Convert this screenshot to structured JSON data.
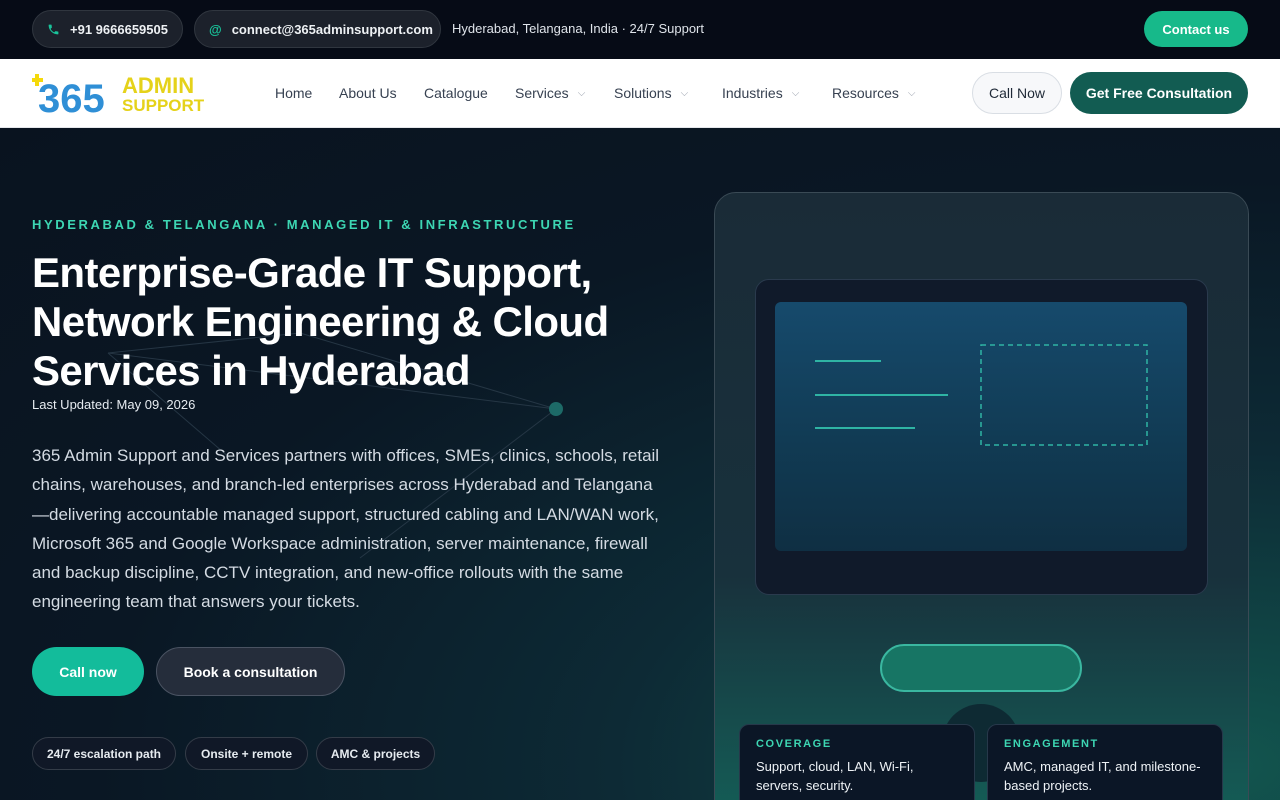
{
  "topbar": {
    "phone": "+91 9666659505",
    "email": "connect@365adminsupport.com",
    "location": "Hyderabad, Telangana, India · 24/7 Support",
    "contact_label": "Contact us"
  },
  "logo": {
    "line1": "365",
    "line2": "ADMIN",
    "line3": "SUPPORT"
  },
  "nav": {
    "items": [
      {
        "label": "Home"
      },
      {
        "label": "About Us"
      },
      {
        "label": "Catalogue"
      },
      {
        "label": "Services"
      },
      {
        "label": "Solutions"
      },
      {
        "label": "Industries"
      },
      {
        "label": "Resources"
      }
    ],
    "call_now": "Call Now",
    "consultation": "Get Free Consultation"
  },
  "hero": {
    "kicker": "HYDERABAD & TELANGANA · MANAGED IT & INFRASTRUCTURE",
    "headline": "Enterprise-Grade IT Support, Network Engineering & Cloud Services in Hyderabad",
    "updated": "Last Updated: May 09, 2026",
    "description": "365 Admin Support and Services partners with offices, SMEs, clinics, schools, retail chains, warehouses, and branch-led enterprises across Hyderabad and Telangana—delivering accountable managed support, structured cabling and LAN/WAN work, Microsoft 365 and Google Workspace administration, server maintenance, firewall and backup discipline, CCTV integration, and new-office rollouts with the same engineering team that answers your tickets.",
    "cta_call": "Call now",
    "cta_book": "Book a consultation",
    "chips": [
      "24/7 escalation path",
      "Onsite + remote",
      "AMC & projects"
    ]
  },
  "cards": [
    {
      "label": "COVERAGE",
      "text": "Support, cloud, LAN, Wi-Fi, servers, security."
    },
    {
      "label": "ENGAGEMENT",
      "text": "AMC, managed IT, and milestone-based projects."
    }
  ],
  "colors": {
    "accent": "#13bc9b",
    "brand_dark": "#125c52",
    "kicker": "#3dd6b3"
  }
}
